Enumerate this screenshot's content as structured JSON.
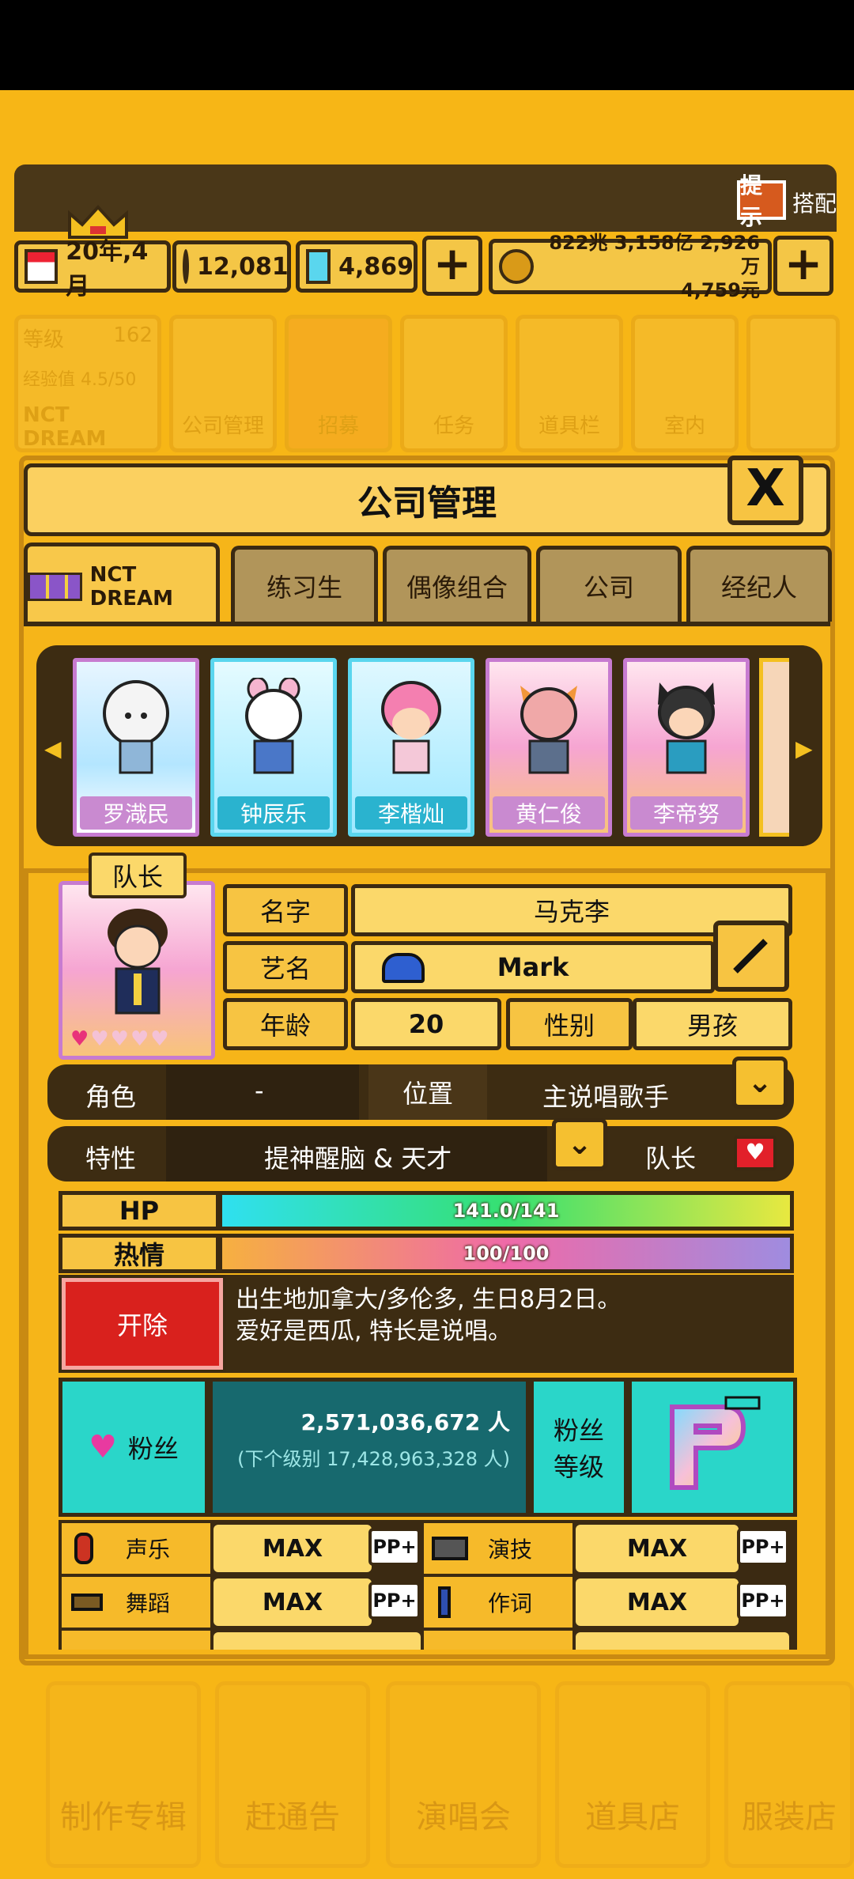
{
  "hud": {
    "hint_label": "提示",
    "hint_extra": "搭配",
    "date": "20年,4月",
    "gems_pink": "12,081",
    "gems_blue": "4,869",
    "money_line1": "822兆 3,158亿 2,926万",
    "money_line2": "4,759元"
  },
  "nav": {
    "level_label": "等级",
    "level_value": "162",
    "exp_label": "经验值 4.5/50",
    "group_name": "NCT DREAM",
    "items": [
      "公司管理",
      "招募",
      "任务",
      "道具栏",
      "室内"
    ]
  },
  "panel": {
    "title": "公司管理",
    "close_label": "X",
    "tabs": [
      "NCT DREAM",
      "练习生",
      "偶像组合",
      "公司",
      "经纪人"
    ]
  },
  "members": [
    {
      "name": "罗渽民"
    },
    {
      "name": "钟辰乐"
    },
    {
      "name": "李楷灿"
    },
    {
      "name": "黄仁俊"
    },
    {
      "name": "李帝努"
    }
  ],
  "profile": {
    "leader_badge": "队长",
    "name_label": "名字",
    "name_value": "马克李",
    "stage_label": "艺名",
    "stage_value": "Mark",
    "age_label": "年龄",
    "age_value": "20",
    "gender_label": "性别",
    "gender_value": "男孩",
    "role_label": "角色",
    "role_value": "-",
    "position_label": "位置",
    "position_value": "主说唱歌手",
    "trait_label": "特性",
    "trait_value": "提神醒脑 & 天才",
    "leader_label": "队长",
    "hp_label": "HP",
    "hp_text": "141.0/141",
    "hp_fraction": 1.0,
    "passion_label": "热情",
    "passion_text": "100/100",
    "passion_fraction": 1.0,
    "dismiss_label": "开除",
    "bio_line1": "出生地加拿大/多伦多, 生日8月2日。",
    "bio_line2": "爱好是西瓜, 特长是说唱。",
    "fans_label": "粉丝",
    "fans_value": "2,571,036,672 人",
    "fans_next": "(下个级别 17,428,963,328 人)",
    "fan_level_label1": "粉丝",
    "fan_level_label2": "等级"
  },
  "stats": [
    {
      "label": "声乐",
      "value": "MAX",
      "pp": "PP+",
      "icon": "microphone-icon"
    },
    {
      "label": "演技",
      "value": "MAX",
      "pp": "PP+",
      "icon": "camera-icon"
    },
    {
      "label": "舞蹈",
      "value": "MAX",
      "pp": "PP+",
      "icon": "shoe-icon"
    },
    {
      "label": "作词",
      "value": "MAX",
      "pp": "PP+",
      "icon": "pen-icon"
    }
  ],
  "bottom_menu": [
    "制作专辑",
    "赶通告",
    "演唱会",
    "道具店",
    "服装店"
  ],
  "colors": {
    "background": "#f7b616",
    "dark_brown": "#3b2a12",
    "panel_yellow": "#f7c442",
    "fans_teal": "#2ad6c9",
    "dismiss_red": "#d9211d"
  }
}
